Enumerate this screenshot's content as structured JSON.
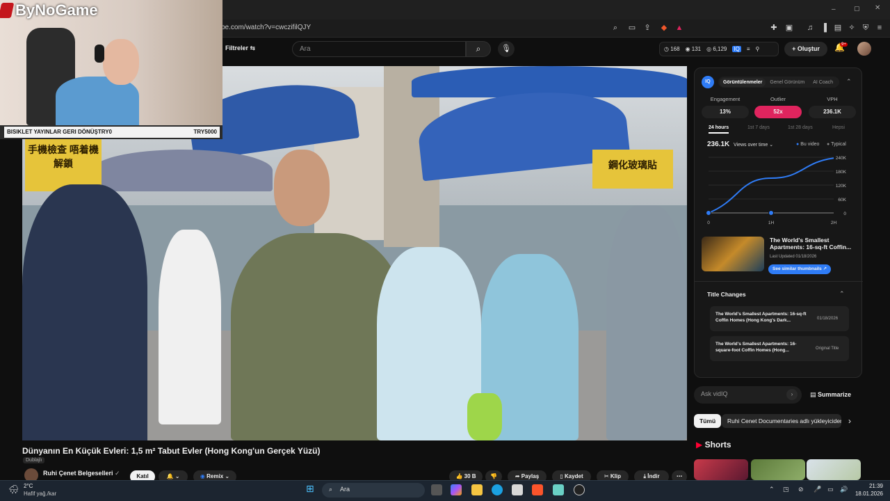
{
  "browser": {
    "url": "be.com/watch?v=cwczifilQJY"
  },
  "header": {
    "filters_label": "Filtreler",
    "search_placeholder": "Ara",
    "stats": {
      "a": "168",
      "b": "131",
      "c": "6,129"
    },
    "create_label": "Oluştur",
    "notifications_badge": "9+"
  },
  "overlay": {
    "brand": "ByNoGame",
    "strip_left": "BISIKLET YAYINLAR GERI DÖNÜŞTRY0",
    "strip_right": "TRY5000"
  },
  "video": {
    "title": "Dünyanın En Küçük Evleri: 1,5 m² Tabut Evler (Hong Kong'un Gerçek Yüzü)",
    "dubbed": "Dublajlı",
    "channel": "Ruhi Çenet Belgeselleri",
    "join_label": "Katıl",
    "remix_label": "Remix",
    "likes": "30 B",
    "share_label": "Paylaş",
    "save_label": "Kaydet",
    "clip_label": "Klip",
    "download_label": "İndir",
    "signs": {
      "left": "手機檢查 唔着機解鎖",
      "right": "鋼化玻璃貼"
    }
  },
  "vidiq": {
    "tabs": [
      "Görüntülenmeler",
      "Genel Görünüm",
      "AI Coach"
    ],
    "metrics": [
      {
        "label": "Engagement",
        "value": "13%"
      },
      {
        "label": "Outlier",
        "value": "52x"
      },
      {
        "label": "VPH",
        "value": "236.1K"
      }
    ],
    "time_tabs": [
      "24 hours",
      "1st 7 days",
      "1st 28 days",
      "Hepsi"
    ],
    "views": "236.1K",
    "views_selector": "Views over time",
    "legend": [
      "Bu video",
      "Typical"
    ],
    "y_ticks": [
      "240K",
      "180K",
      "120K",
      "60K",
      "0"
    ],
    "x_ticks": [
      "0",
      "1H",
      "2H"
    ],
    "similar_title": "The World's Smallest Apartments: 16-sq-ft Coffin...",
    "last_updated": "Last Updated 01/18/2026",
    "similar_button": "See similar thumbnails",
    "title_changes_header": "Title Changes",
    "title_changes": [
      {
        "title": "The World's Smallest Apartments: 16-sq-ft Coffin Homes (Hong Kong's Dark...",
        "meta": "01/18/2026"
      },
      {
        "title": "The World's Smallest Apartments: 16-square-foot Coffin Homes (Hong...",
        "meta": "Original Title"
      }
    ],
    "ask_placeholder": "Ask vidIQ",
    "summarize_label": "Summarize",
    "accent": "#2f7cf6",
    "outlier_color": "#e0245e"
  },
  "chart_data": {
    "type": "line",
    "x": [
      "0",
      "1H",
      "2H"
    ],
    "series": [
      {
        "name": "Bu video",
        "values": [
          0,
          150000,
          236100
        ]
      },
      {
        "name": "Typical",
        "values": [
          0,
          0,
          0
        ]
      }
    ],
    "ylim": [
      0,
      240000
    ],
    "y_ticks": [
      "0",
      "60K",
      "120K",
      "180K",
      "240K"
    ]
  },
  "recommendations": {
    "chip_all": "Tümü",
    "chip_channel": "Ruhi Cenet Documentaries adlı yükleyiciden",
    "shorts_label": "Shorts"
  },
  "taskbar": {
    "temperature": "2°C",
    "weather": "Hafif yağ./kar",
    "search": "Ara",
    "time": "21:39",
    "date": "18.01.2026"
  }
}
